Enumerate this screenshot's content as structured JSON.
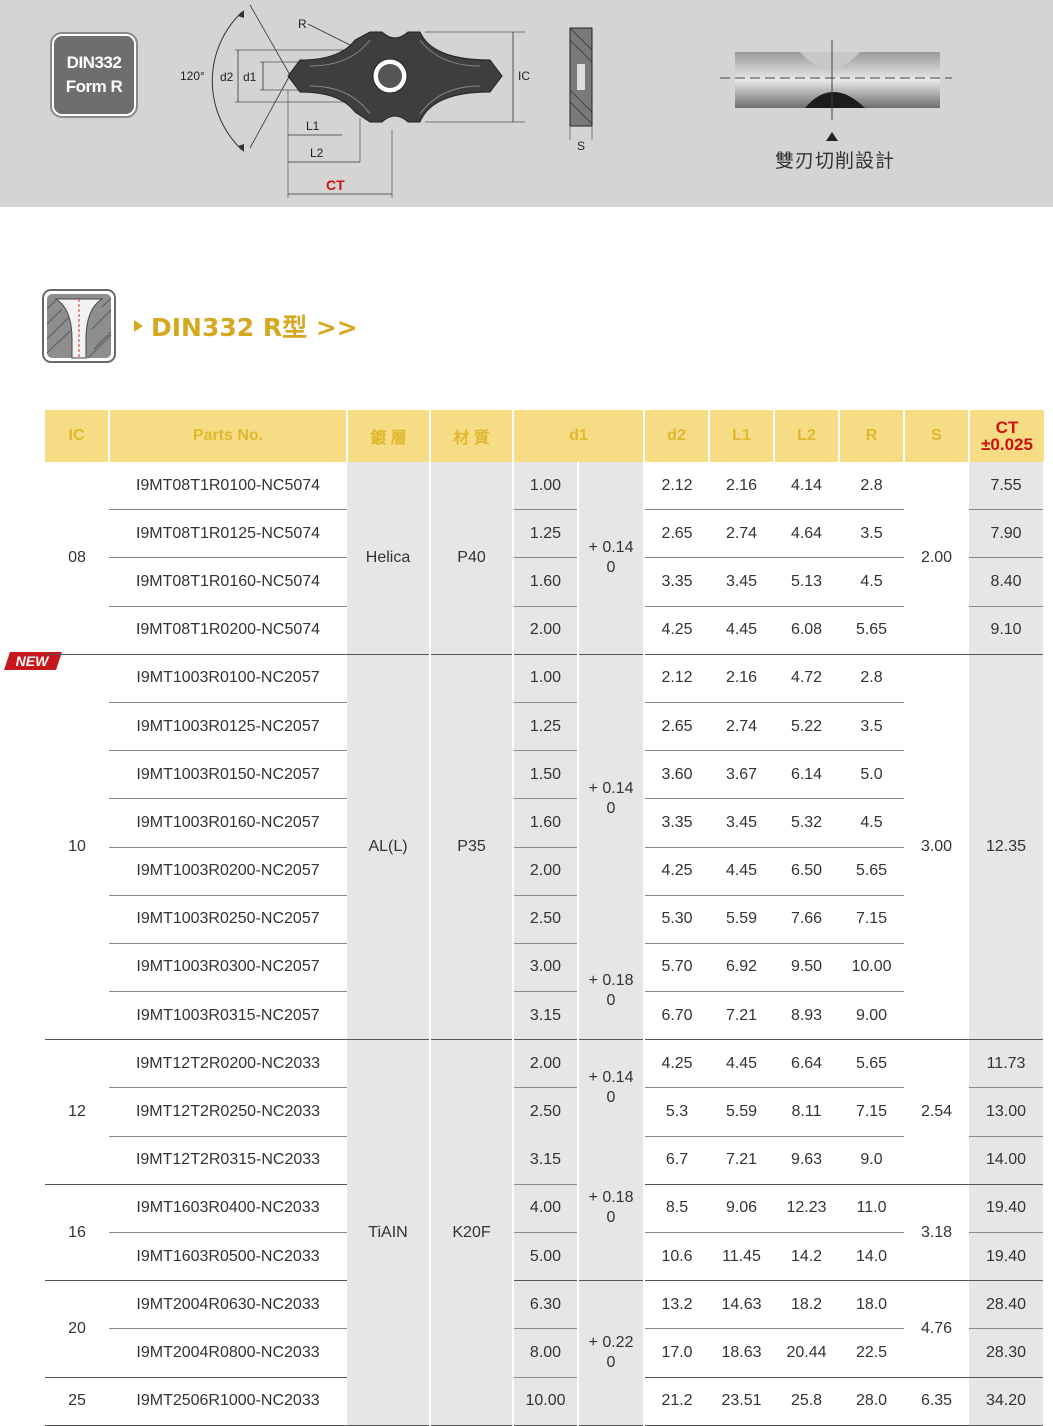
{
  "banner": {
    "badge_line1": "DIN332",
    "badge_line2": "Form R",
    "diagram_labels": {
      "angle": "120°",
      "d2": "d2",
      "d1": "d1",
      "r": "R",
      "ic": "IC",
      "l1": "L1",
      "l2": "L2",
      "ct": "CT",
      "s": "S"
    },
    "caption": "雙刃切削設計"
  },
  "section": {
    "title": "DIN332 R型 >>"
  },
  "new_tag": "NEW",
  "table": {
    "headers": [
      "IC",
      "Parts No.",
      "鍍 層",
      "材 質",
      "d1",
      "d2",
      "L1",
      "L2",
      "R",
      "S",
      "CT",
      "±0.025"
    ],
    "groups": [
      {
        "ic": "08",
        "coating": "Helica",
        "material": "P40",
        "s": "2.00",
        "rows": [
          {
            "part": "I9MT08T1R0100-NC5074",
            "d1": "1.00",
            "d2": "2.12",
            "l1": "2.16",
            "l2": "4.14",
            "r": "2.8",
            "ct": "7.55"
          },
          {
            "part": "I9MT08T1R0125-NC5074",
            "d1": "1.25",
            "d2": "2.65",
            "l1": "2.74",
            "l2": "4.64",
            "r": "3.5",
            "ct": "7.90"
          },
          {
            "part": "I9MT08T1R0160-NC5074",
            "d1": "1.60",
            "d2": "3.35",
            "l1": "3.45",
            "l2": "5.13",
            "r": "4.5",
            "ct": "8.40"
          },
          {
            "part": "I9MT08T1R0200-NC5074",
            "d1": "2.00",
            "d2": "4.25",
            "l1": "4.45",
            "l2": "6.08",
            "r": "5.65",
            "ct": "9.10"
          }
        ],
        "tolerances": [
          {
            "plus": "+ 0.14",
            "minus": "0"
          }
        ]
      },
      {
        "ic": "10",
        "coating": "AL(L)",
        "material": "P35",
        "s": "3.00",
        "ct": "12.35",
        "rows": [
          {
            "part": "I9MT1003R0100-NC2057",
            "d1": "1.00",
            "d2": "2.12",
            "l1": "2.16",
            "l2": "4.72",
            "r": "2.8"
          },
          {
            "part": "I9MT1003R0125-NC2057",
            "d1": "1.25",
            "d2": "2.65",
            "l1": "2.74",
            "l2": "5.22",
            "r": "3.5"
          },
          {
            "part": "I9MT1003R0150-NC2057",
            "d1": "1.50",
            "d2": "3.60",
            "l1": "3.67",
            "l2": "6.14",
            "r": "5.0"
          },
          {
            "part": "I9MT1003R0160-NC2057",
            "d1": "1.60",
            "d2": "3.35",
            "l1": "3.45",
            "l2": "5.32",
            "r": "4.5"
          },
          {
            "part": "I9MT1003R0200-NC2057",
            "d1": "2.00",
            "d2": "4.25",
            "l1": "4.45",
            "l2": "6.50",
            "r": "5.65"
          },
          {
            "part": "I9MT1003R0250-NC2057",
            "d1": "2.50",
            "d2": "5.30",
            "l1": "5.59",
            "l2": "7.66",
            "r": "7.15"
          },
          {
            "part": "I9MT1003R0300-NC2057",
            "d1": "3.00",
            "d2": "5.70",
            "l1": "6.92",
            "l2": "9.50",
            "r": "10.00"
          },
          {
            "part": "I9MT1003R0315-NC2057",
            "d1": "3.15",
            "d2": "6.70",
            "l1": "7.21",
            "l2": "8.93",
            "r": "9.00"
          }
        ],
        "tolerances": [
          {
            "plus": "+ 0.14",
            "minus": "0"
          },
          {
            "plus": "+ 0.18",
            "minus": "0"
          }
        ]
      },
      {
        "coating": "TiAIN",
        "material": "K20F",
        "subgroups": [
          {
            "ic": "12",
            "s": "2.54",
            "rows": [
              {
                "part": "I9MT12T2R0200-NC2033",
                "d1": "2.00",
                "d2": "4.25",
                "l1": "4.45",
                "l2": "6.64",
                "r": "5.65",
                "ct": "11.73"
              },
              {
                "part": "I9MT12T2R0250-NC2033",
                "d1": "2.50",
                "d2": "5.3",
                "l1": "5.59",
                "l2": "8.11",
                "r": "7.15",
                "ct": "13.00"
              },
              {
                "part": "I9MT12T2R0315-NC2033",
                "d1": "3.15",
                "d2": "6.7",
                "l1": "7.21",
                "l2": "9.63",
                "r": "9.0",
                "ct": "14.00"
              }
            ]
          },
          {
            "ic": "16",
            "s": "3.18",
            "rows": [
              {
                "part": "I9MT1603R0400-NC2033",
                "d1": "4.00",
                "d2": "8.5",
                "l1": "9.06",
                "l2": "12.23",
                "r": "11.0",
                "ct": "19.40"
              },
              {
                "part": "I9MT1603R0500-NC2033",
                "d1": "5.00",
                "d2": "10.6",
                "l1": "11.45",
                "l2": "14.2",
                "r": "14.0",
                "ct": "19.40"
              }
            ]
          },
          {
            "ic": "20",
            "s": "4.76",
            "rows": [
              {
                "part": "I9MT2004R0630-NC2033",
                "d1": "6.30",
                "d2": "13.2",
                "l1": "14.63",
                "l2": "18.2",
                "r": "18.0",
                "ct": "28.40"
              },
              {
                "part": "I9MT2004R0800-NC2033",
                "d1": "8.00",
                "d2": "17.0",
                "l1": "18.63",
                "l2": "20.44",
                "r": "22.5",
                "ct": "28.30"
              }
            ]
          },
          {
            "ic": "25",
            "s": "6.35",
            "rows": [
              {
                "part": "I9MT2506R1000-NC2033",
                "d1": "10.00",
                "d2": "21.2",
                "l1": "23.51",
                "l2": "25.8",
                "r": "28.0",
                "ct": "34.20"
              }
            ]
          }
        ],
        "tolerances": [
          {
            "plus": "+ 0.14",
            "minus": "0"
          },
          {
            "plus": "+ 0.18",
            "minus": "0"
          },
          {
            "plus": "+ 0.22",
            "minus": "0"
          }
        ]
      }
    ]
  }
}
